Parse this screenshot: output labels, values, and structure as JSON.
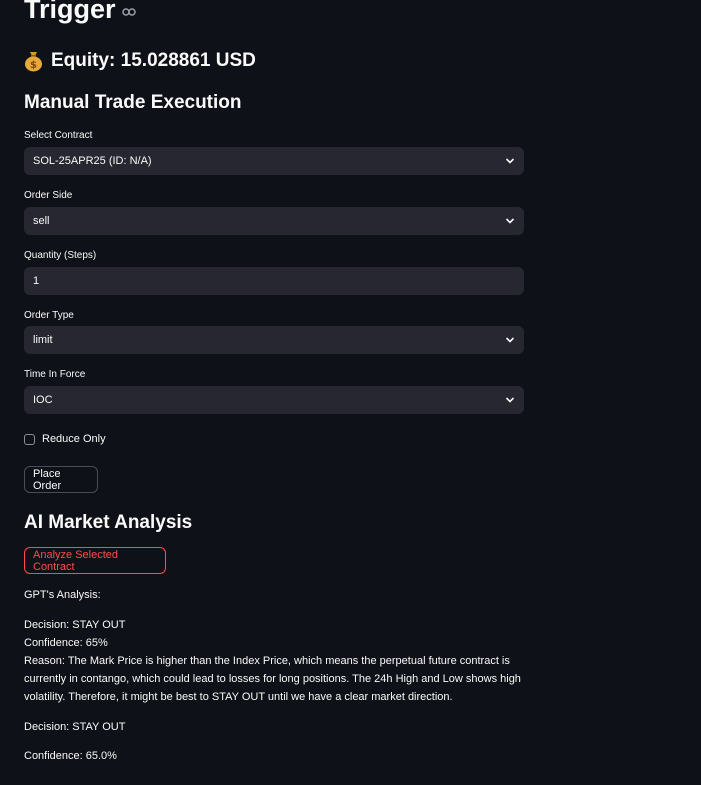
{
  "header": {
    "title": "Trigger",
    "equity": "Equity: 15.028861 USD"
  },
  "manual_trade": {
    "heading": "Manual Trade Execution",
    "contract": {
      "label": "Select Contract",
      "value": "SOL-25APR25 (ID: N/A)"
    },
    "side": {
      "label": "Order Side",
      "value": "sell"
    },
    "quantity": {
      "label": "Quantity (Steps)",
      "value": "1"
    },
    "order_type": {
      "label": "Order Type",
      "value": "limit"
    },
    "time_in_force": {
      "label": "Time In Force",
      "value": "IOC"
    },
    "reduce_only_label": "Reduce Only",
    "reduce_only_checked": false,
    "place_order_label": "Place Order"
  },
  "ai": {
    "heading": "AI Market Analysis",
    "analyze_label": "Analyze Selected Contract",
    "gpt_label": "GPT's Analysis:",
    "decision": "Decision: STAY OUT",
    "confidence": "Confidence: 65%",
    "reason": "Reason: The Mark Price is higher than the Index Price, which means the perpetual future contract is currently in contango, which could lead to losses for long positions. The 24h High and Low shows high volatility. Therefore, it might be best to STAY OUT until we have a clear market direction.",
    "final_decision": "Decision: STAY OUT",
    "final_confidence": "Confidence: 65.0%"
  },
  "colors": {
    "background": "#0e1117",
    "input_bg": "#262730",
    "accent_red": "#ff4b4b"
  },
  "icons": {
    "title_link": "link-icon",
    "equity": "money-bag-icon",
    "dropdown": "chevron-down-icon"
  }
}
